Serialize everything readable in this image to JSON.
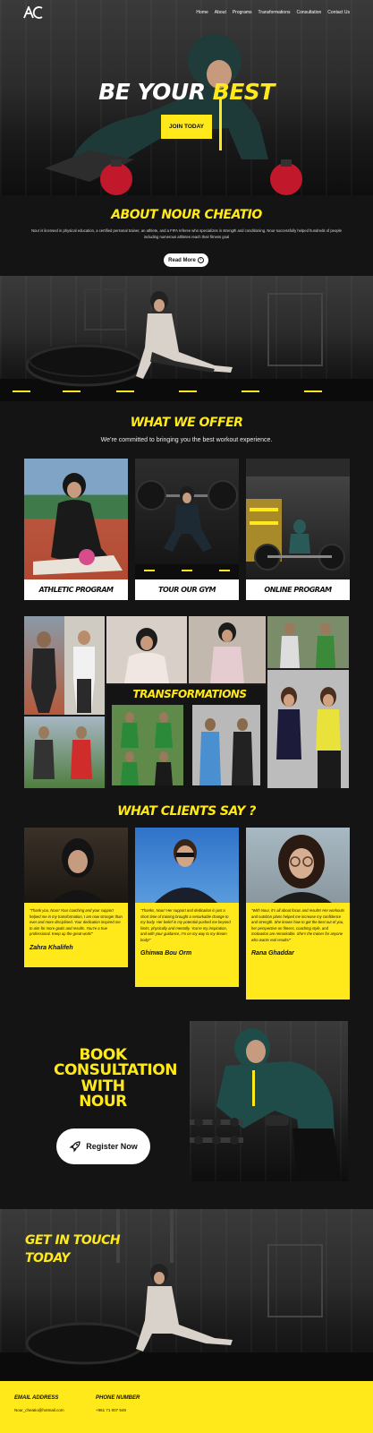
{
  "nav": {
    "logo": "ANC",
    "links": [
      "Home",
      "About",
      "Programs",
      "Transformations",
      "Consultation",
      "Contact Us"
    ]
  },
  "hero": {
    "title_part1": "BE YOUR ",
    "title_part2": "BEST",
    "join_label": "JOIN TODAY"
  },
  "about": {
    "title": "ABOUT NOUR CHEATIO",
    "text": "Nour is licensed in physical education, a certified personal trainer, an athlete, and a FIFA referee who specializes in strength and conditioning. Nour successfully helped hundreds of people including numerous athletes reach their fitness goal",
    "read_more": "Read More"
  },
  "offer": {
    "title": "WHAT WE OFFER",
    "subtitle": "We’re committed to bringing you the best workout experience.",
    "cards": [
      {
        "label": "ATHLETIC PROGRAM"
      },
      {
        "label": "TOUR OUR GYM"
      },
      {
        "label": "ONLINE PROGRAM"
      }
    ]
  },
  "transformations": {
    "title": "TRANSFORMATIONS"
  },
  "testimonials": {
    "title": "WHAT CLIENTS SAY ?",
    "items": [
      {
        "quote": "“Thank you, Nour! Your coaching and your support helped me in my transformation, I am now stronger than ever and more disciplined. Your dedication inspired me to aim for more goals and results. You’re a true professional. Keep up the great work!”",
        "name": "Zahra Khalifeh"
      },
      {
        "quote": "“Thanks, Nour! Her support and dedication in just a short time of training brought a remarkable change to my body. Her belief in my potential pushed me beyond limits, physically and mentally. You’re my inspiration, and with your guidance, I’m on my way to my dream body!”",
        "name": "Ghinwa Bou Orm"
      },
      {
        "quote": "“With Nour, it’s all about focus and results! Her workouts and nutrition plans helped me increase my confidence and strength. She knows how to get the best out of you, her perspective on fitness, coaching style, and motivation are remarkable. She’s the trainer for anyone who wants real results!”",
        "name": "Rana Ghaddar"
      }
    ]
  },
  "consult": {
    "title_lines": [
      "BOOK",
      "CONSULTATION",
      "WITH",
      "NOUR"
    ],
    "register_label": "Register Now"
  },
  "contact": {
    "title_line1": "GET IN TOUCH",
    "title_line2": "TODAY",
    "email_label": "EMAIL ADDRESS",
    "email_value": "Nour_cheatio@hotmail.com",
    "phone_label": "PHONE NUMBER",
    "phone_value": "+961 71 007 549"
  },
  "colors": {
    "accent": "#ffe91a",
    "background": "#141414"
  },
  "icons": {
    "read_more": "arrow-right-circle-icon",
    "register": "rocket-icon"
  }
}
